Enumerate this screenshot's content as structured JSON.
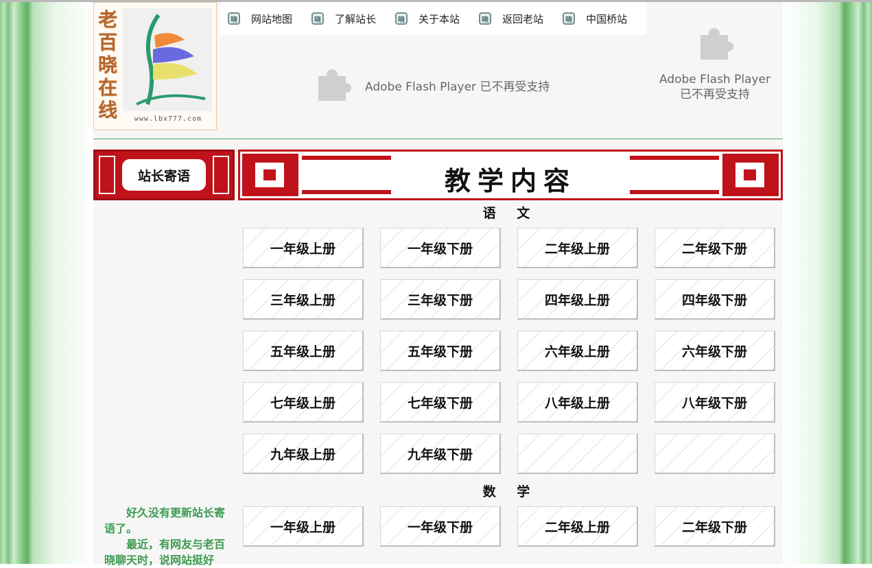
{
  "logo": {
    "chars": [
      "老",
      "百",
      "晓",
      "在",
      "线"
    ],
    "url": "www.lbx777.com"
  },
  "nav": {
    "icon_char": "晓",
    "items": [
      "网站地图",
      "了解站长",
      "关于本站",
      "返回老站",
      "中国桥站"
    ]
  },
  "flash_main": "Adobe Flash Player 已不再受支持",
  "flash_side": {
    "line1": "Adobe Flash Player",
    "line2": "已不再受支持"
  },
  "sidebar": {
    "banner": "站长寄语",
    "message": [
      "好久没有更新站长寄语了。",
      "最近，有网友与老百晓聊天时，说网站挺好"
    ]
  },
  "main": {
    "banner": "教学内容",
    "subjects": [
      {
        "name": "语 文",
        "grades": [
          "一年级上册",
          "一年级下册",
          "二年级上册",
          "二年级下册",
          "三年级上册",
          "三年级下册",
          "四年级上册",
          "四年级下册",
          "五年级上册",
          "五年级下册",
          "六年级上册",
          "六年级下册",
          "七年级上册",
          "七年级下册",
          "八年级上册",
          "八年级下册",
          "九年级上册",
          "九年级下册",
          "",
          ""
        ]
      },
      {
        "name": "数 学",
        "grades": [
          "一年级上册",
          "一年级下册",
          "二年级上册",
          "二年级下册"
        ]
      }
    ]
  },
  "colors": {
    "accent_red": "#c0121b",
    "note_green": "#3c9a50",
    "frame_green": "#7cc17e"
  }
}
